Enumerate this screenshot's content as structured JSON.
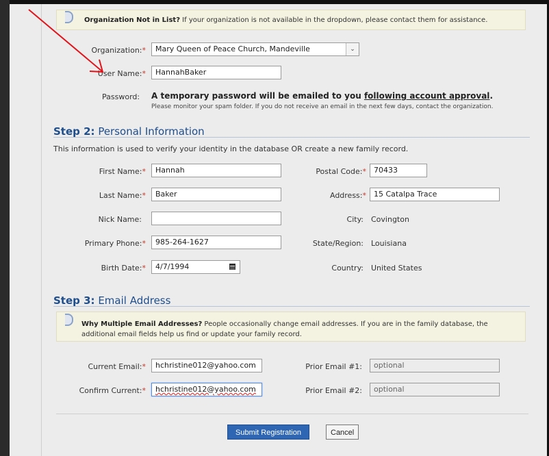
{
  "notice_org": {
    "bold": "Organization Not in List?",
    "text": " If your organization is not available in the dropdown, please contact them for assistance."
  },
  "account": {
    "organization_label": "Organization:",
    "organization_value": "Mary Queen of Peace Church, Mandeville",
    "username_label": "User Name:",
    "username_value": "HannahBaker",
    "password_label": "Password:",
    "password_main_pre": "A temporary password will be emailed to you ",
    "password_main_link": "following account approval",
    "password_main_post": ".",
    "password_sub": "Please monitor your spam folder. If you do not receive an email in the next few days, contact the organization."
  },
  "step2": {
    "num": "Step 2:",
    "title": " Personal Information",
    "desc": "This information is used to verify your identity in the database OR create a new family record.",
    "first_name_label": "First Name:",
    "first_name_value": "Hannah",
    "last_name_label": "Last Name:",
    "last_name_value": "Baker",
    "nick_name_label": "Nick Name:",
    "nick_name_value": "",
    "phone_label": "Primary Phone:",
    "phone_value": "985-264-1627",
    "birth_label": "Birth Date:",
    "birth_value": "4/7/1994",
    "postal_label": "Postal Code:",
    "postal_value": "70433",
    "address_label": "Address:",
    "address_value": "15 Catalpa Trace",
    "city_label": "City:",
    "city_value": "Covington",
    "state_label": "State/Region:",
    "state_value": "Louisiana",
    "country_label": "Country:",
    "country_value": "United States"
  },
  "step3": {
    "num": "Step 3:",
    "title": " Email Address",
    "notice_bold": "Why Multiple Email Addresses?",
    "notice_line1": " People occasionally change email addresses. If you are in the family database, the",
    "notice_line2": "additional email fields help us find or update your family record.",
    "current_label": "Current Email:",
    "current_value": "hchristine012@yahoo.com",
    "confirm_label": "Confirm Current:",
    "confirm_value": "hchristine012@yahoo.com",
    "prior1_label": "Prior Email #1:",
    "prior1_placeholder": "optional",
    "prior2_label": "Prior Email #2:",
    "prior2_placeholder": "optional"
  },
  "actions": {
    "submit": "Submit Registration",
    "cancel": "Cancel"
  },
  "colors": {
    "annotation_arrow": "#e0141b",
    "step_heading": "#1f4e8c",
    "required_star": "#c0392b",
    "primary_button": "#2f66b3"
  }
}
